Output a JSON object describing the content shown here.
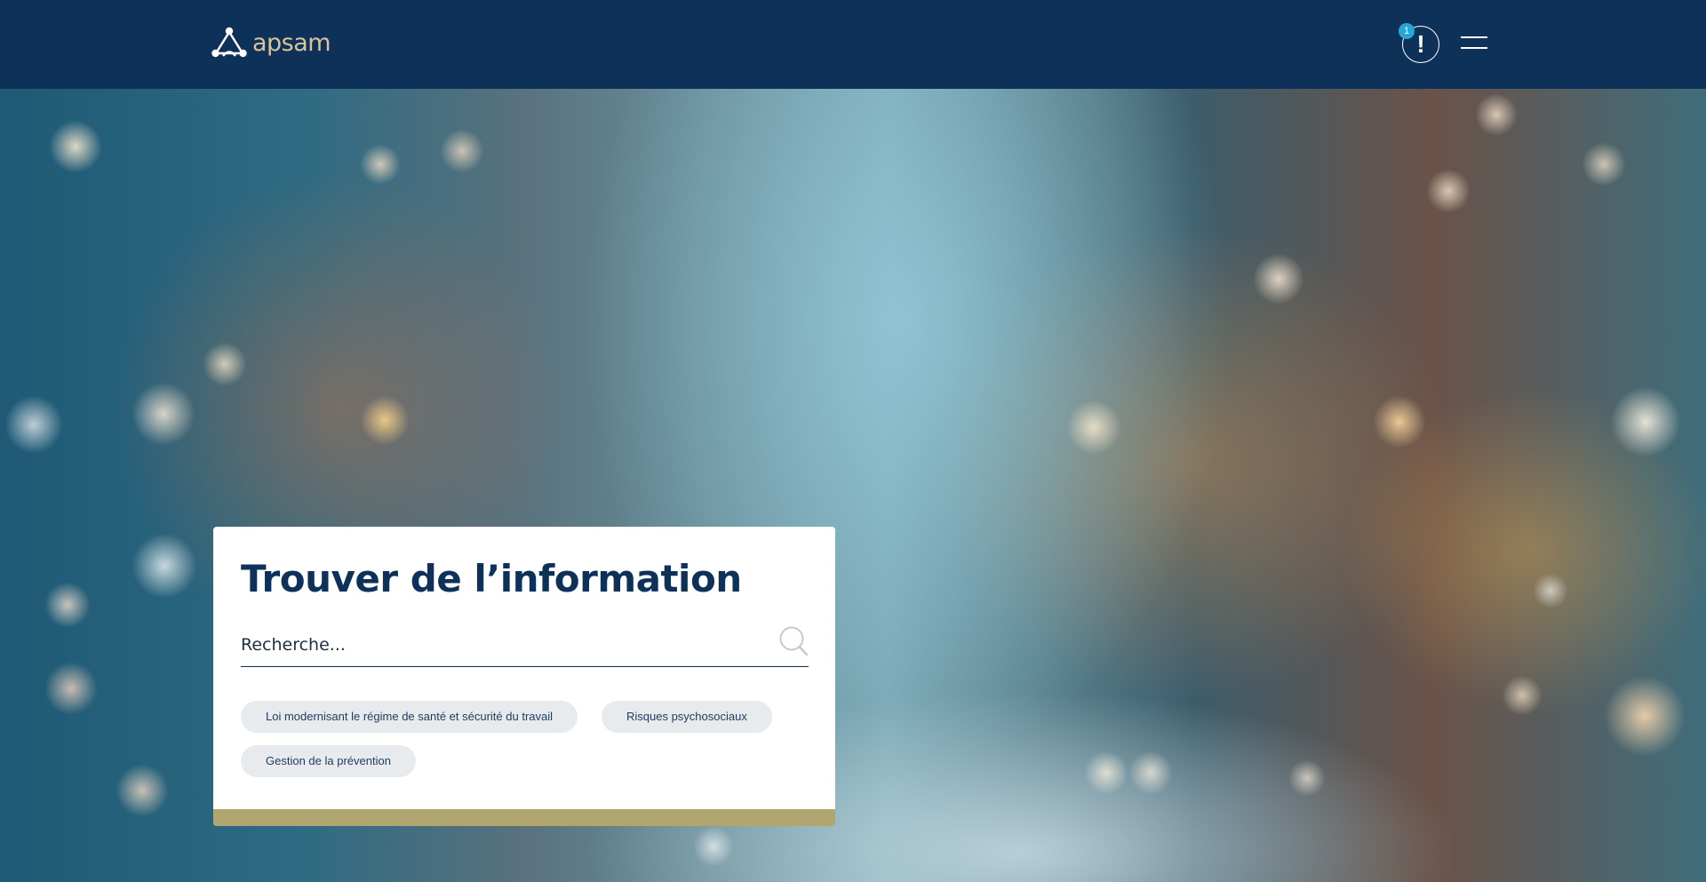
{
  "header": {
    "logo_text": "apsam",
    "alert_badge": "1",
    "alert_mark": "!"
  },
  "search": {
    "title": "Trouver de l’information",
    "placeholder": "Recherche...",
    "chips": [
      "Loi modernisant le régime de santé et sécurité du travail",
      "Risques psychosociaux",
      "Gestion de la prévention"
    ]
  },
  "colors": {
    "header_bg": "#0e3159",
    "title_text": "#0e3159",
    "logo_accent": "#d7c49a",
    "badge": "#2aa6d6",
    "chip_bg": "#e7ebee",
    "card_bottom_bar": "#b2a670",
    "search_icon": "#c5c9cc"
  },
  "icons": {
    "logo": "triangle-people-logo-icon",
    "alert": "exclamation-icon",
    "menu": "hamburger-menu-icon",
    "search": "search-icon"
  }
}
